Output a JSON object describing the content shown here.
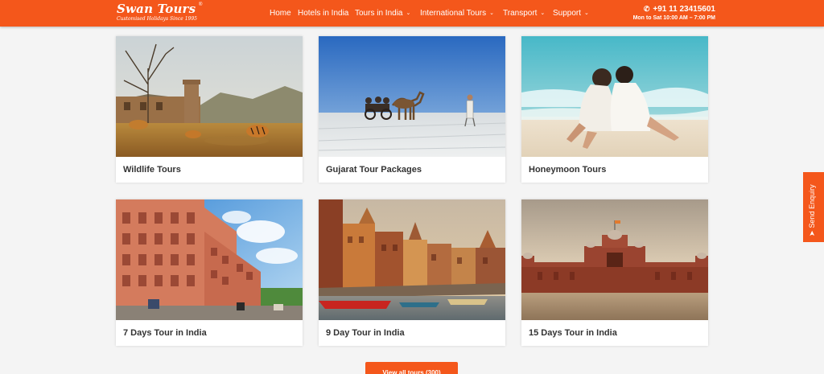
{
  "brand": {
    "name": "Swan Tours",
    "registered": "®",
    "tagline": "Customised Holidays Since 1995"
  },
  "nav": {
    "items": [
      {
        "label": "Home",
        "has_dropdown": false
      },
      {
        "label": "Hotels in India",
        "has_dropdown": false
      },
      {
        "label": "Tours in India",
        "has_dropdown": true
      },
      {
        "label": "International Tours",
        "has_dropdown": true
      },
      {
        "label": "Transport",
        "has_dropdown": true
      },
      {
        "label": "Support",
        "has_dropdown": true
      }
    ]
  },
  "contact": {
    "phone_icon": "phone-icon",
    "phone": "+91 11 23415601",
    "hours": "Mon to Sat 10:00 AM – 7:00 PM"
  },
  "tours": [
    {
      "title": "Wildlife Tours",
      "image": "tigers near fort ruins"
    },
    {
      "title": "Gujarat Tour Packages",
      "image": "camel cart on white salt desert"
    },
    {
      "title": "Honeymoon Tours",
      "image": "couple sitting on beach"
    },
    {
      "title": "7 Days Tour in India",
      "image": "pink palace facade"
    },
    {
      "title": "9 Day Tour in India",
      "image": "riverside ghats with boats"
    },
    {
      "title": "15 Days Tour in India",
      "image": "red sandstone fort at dusk"
    }
  ],
  "view_all_label": "View all tours (300)",
  "enquiry": {
    "icon": "send-icon",
    "label": "Send Enquiry"
  },
  "colors": {
    "brand_orange": "#f4571b",
    "page_background": "#f4f4f4",
    "card_title": "#333333"
  }
}
